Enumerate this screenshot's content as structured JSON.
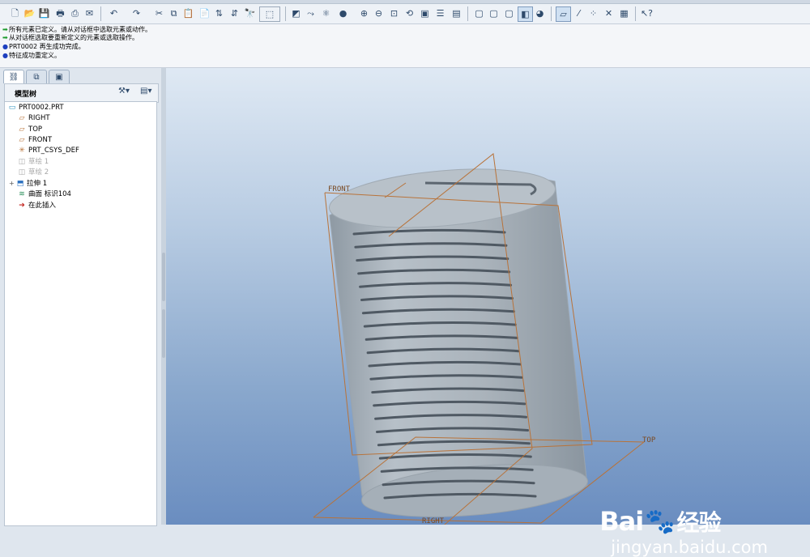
{
  "toolbar": {
    "icons": [
      "new-file-icon",
      "open-folder-icon",
      "save-icon",
      "print-icon",
      "print-preview-icon",
      "email-icon",
      "undo-icon",
      "redo-icon",
      "cut-icon",
      "copy-icon",
      "paste-icon",
      "paste-special-icon",
      "regenerate-icon",
      "regenerate-manager-icon",
      "find-icon",
      "select-box-icon",
      "repaint-icon",
      "spin-center-icon",
      "saved-orientation-icon",
      "shading-icon",
      "zoom-in-icon",
      "zoom-out-icon",
      "refit-icon",
      "reorient-icon",
      "named-views-icon",
      "layers-icon",
      "view-manager-icon",
      "wireframe-icon",
      "hidden-line-icon",
      "no-hidden-icon",
      "shading-edges-icon",
      "appearance-icon",
      "datum-planes-icon",
      "datum-axes-icon",
      "datum-points-icon",
      "coordinate-systems-icon",
      "annotation-icon",
      "help-icon"
    ]
  },
  "messages": [
    {
      "bullet": "green-arrow",
      "text": "所有元素已定义。请从对话框中选取元素或动作。"
    },
    {
      "bullet": "green-arrow",
      "text": "从对话框选取要重新定义的元素或选取操作。"
    },
    {
      "bullet": "blue-dot",
      "text": "PRT0002 再生成功完成。"
    },
    {
      "bullet": "blue-dot",
      "text": "特征成功重定义。"
    }
  ],
  "tree": {
    "title": "模型树",
    "items": [
      {
        "label": "PRT0002.PRT",
        "icon": "part-icon",
        "dim": false
      },
      {
        "label": "RIGHT",
        "icon": "datum-plane-icon",
        "dim": false
      },
      {
        "label": "TOP",
        "icon": "datum-plane-icon",
        "dim": false
      },
      {
        "label": "FRONT",
        "icon": "datum-plane-icon",
        "dim": false
      },
      {
        "label": "PRT_CSYS_DEF",
        "icon": "csys-icon",
        "dim": false
      },
      {
        "label": "草绘 1",
        "icon": "sketch-icon",
        "dim": true
      },
      {
        "label": "草绘 2",
        "icon": "sketch-icon",
        "dim": true
      },
      {
        "label": "拉伸 1",
        "icon": "extrude-icon",
        "dim": false
      },
      {
        "label": "曲面 标识104",
        "icon": "surface-icon",
        "dim": false
      },
      {
        "label": "在此插入",
        "icon": "insert-here-icon",
        "dim": false
      }
    ]
  },
  "viewport": {
    "datum_labels": {
      "front": "FRONT",
      "top": "TOP",
      "right": "RIGHT"
    }
  },
  "watermark": {
    "brand_a": "Bai",
    "brand_b": "经验",
    "url": "jingyan.baidu.com"
  },
  "colors": {
    "datum": "#b8733a",
    "model": "#a9b3bc",
    "background_top": "#dfe9f4",
    "background_bottom": "#6a8dc0"
  }
}
